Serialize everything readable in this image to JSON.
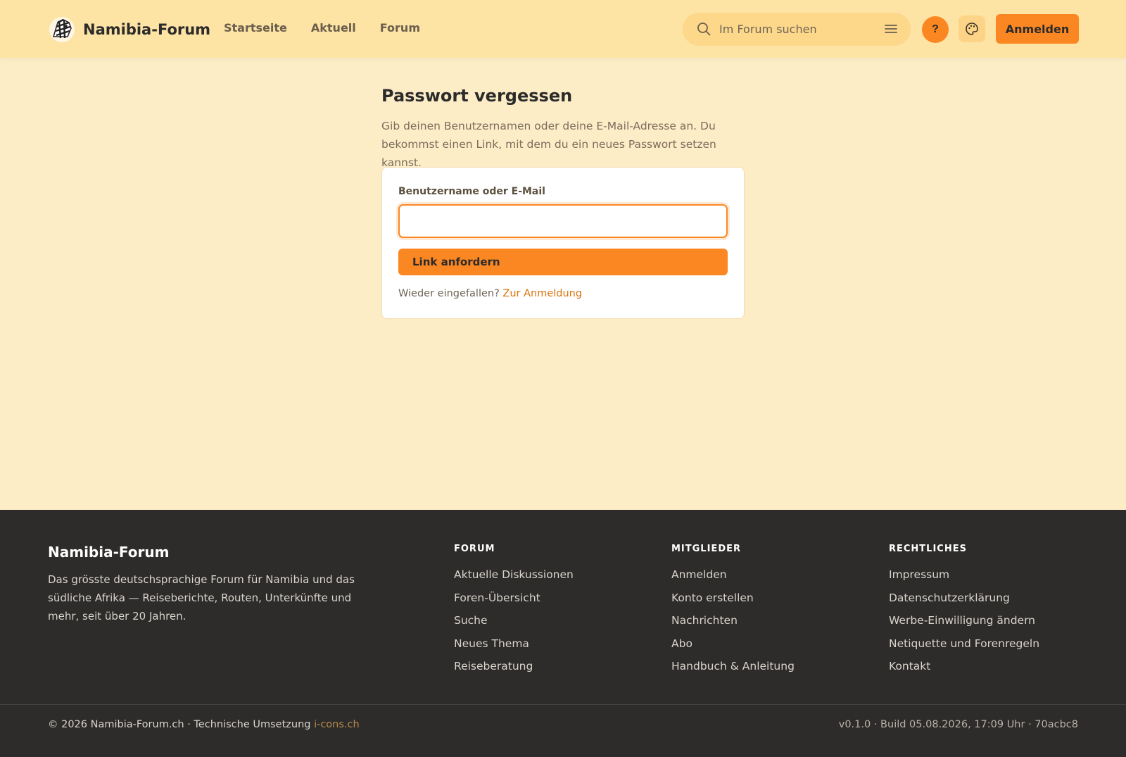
{
  "header": {
    "brand": "Namibia-Forum",
    "nav": [
      "Startseite",
      "Aktuell",
      "Forum"
    ],
    "search_placeholder": "Im Forum suchen",
    "help_label": "?",
    "login_label": "Anmelden"
  },
  "main": {
    "title": "Passwort vergessen",
    "intro": "Gib deinen Benutzernamen oder deine E-Mail-Adresse an. Du bekommst einen Link, mit dem du ein neues Passwort setzen kannst.",
    "field_label": "Benutzername oder E-Mail",
    "field_value": "",
    "submit_label": "Link anfordern",
    "back_text": "Wieder eingefallen?",
    "back_link": "Zur Anmeldung"
  },
  "footer": {
    "brand": "Namibia-Forum",
    "description": "Das grösste deutschsprachige Forum für Namibia und das südliche Afrika — Reiseberichte, Routen, Unterkünfte und mehr, seit über 20 Jahren.",
    "columns": [
      {
        "title": "FORUM",
        "links": [
          "Aktuelle Diskussionen",
          "Foren-Übersicht",
          "Suche",
          "Neues Thema",
          "Reiseberatung"
        ]
      },
      {
        "title": "MITGLIEDER",
        "links": [
          "Anmelden",
          "Konto erstellen",
          "Nachrichten",
          "Abo",
          "Handbuch & Anleitung"
        ]
      },
      {
        "title": "RECHTLICHES",
        "links": [
          "Impressum",
          "Datenschutzerklärung",
          "Werbe-Einwilligung ändern",
          "Netiquette und Forenregeln",
          "Kontakt"
        ]
      }
    ],
    "copyright": "© 2026 Namibia-Forum.ch · Technische Umsetzung",
    "credit": "i-cons.ch",
    "build": "v0.1.0 · Build 05.08.2026, 17:09 Uhr · 70acbc8"
  },
  "colors": {
    "accent": "#fb8722",
    "header_bg": "#fde3a4",
    "page_bg": "#fdedc7",
    "footer_bg": "#2d2c2b",
    "link": "#d9730d"
  },
  "icons": [
    "zebra-logo-icon",
    "search-icon",
    "filter-lines-icon",
    "help-icon",
    "palette-icon"
  ]
}
